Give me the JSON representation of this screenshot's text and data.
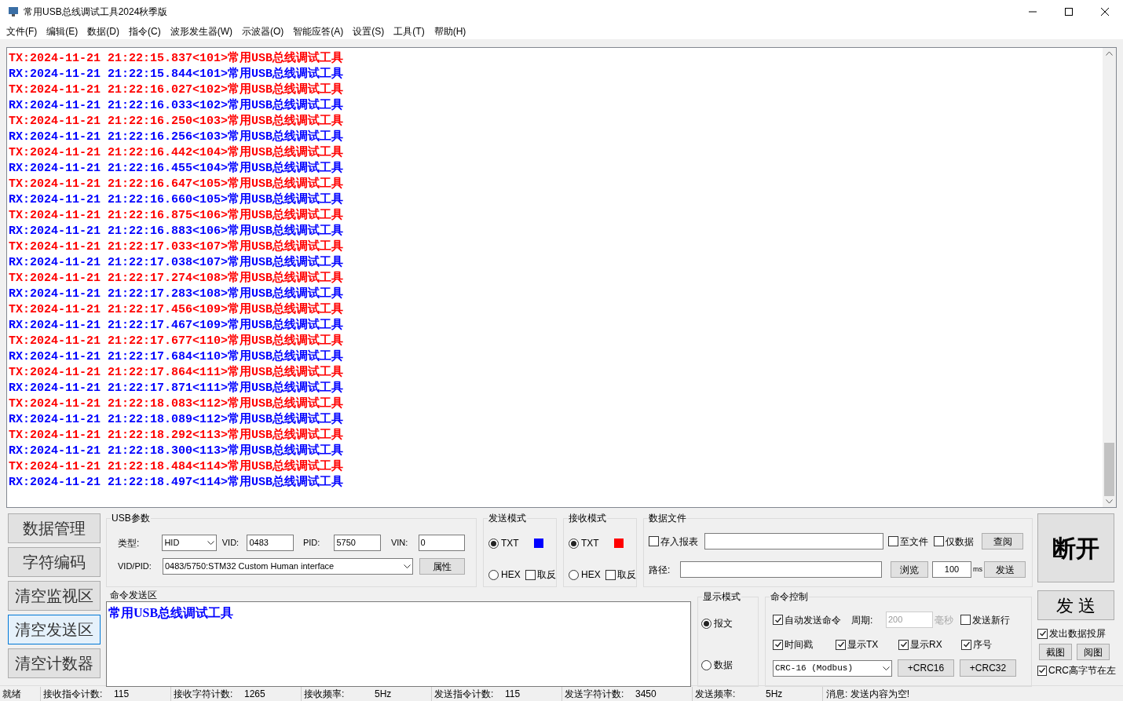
{
  "window": {
    "title": "常用USB总线调试工具2024秋季版"
  },
  "menu": [
    "文件(F)",
    "编辑(E)",
    "数据(D)",
    "指令(C)",
    "波形发生器(W)",
    "示波器(O)",
    "智能应答(A)",
    "设置(S)",
    "工具(T)",
    "帮助(H)"
  ],
  "log": {
    "lines": [
      {
        "kind": "tx",
        "text": "TX:2024-11-21 21:22:15.837<101>常用USB总线调试工具"
      },
      {
        "kind": "rx",
        "text": "RX:2024-11-21 21:22:15.844<101>常用USB总线调试工具"
      },
      {
        "kind": "tx",
        "text": "TX:2024-11-21 21:22:16.027<102>常用USB总线调试工具"
      },
      {
        "kind": "rx",
        "text": "RX:2024-11-21 21:22:16.033<102>常用USB总线调试工具"
      },
      {
        "kind": "tx",
        "text": "TX:2024-11-21 21:22:16.250<103>常用USB总线调试工具"
      },
      {
        "kind": "rx",
        "text": "RX:2024-11-21 21:22:16.256<103>常用USB总线调试工具"
      },
      {
        "kind": "tx",
        "text": "TX:2024-11-21 21:22:16.442<104>常用USB总线调试工具"
      },
      {
        "kind": "rx",
        "text": "RX:2024-11-21 21:22:16.455<104>常用USB总线调试工具"
      },
      {
        "kind": "tx",
        "text": "TX:2024-11-21 21:22:16.647<105>常用USB总线调试工具"
      },
      {
        "kind": "rx",
        "text": "RX:2024-11-21 21:22:16.660<105>常用USB总线调试工具"
      },
      {
        "kind": "tx",
        "text": "TX:2024-11-21 21:22:16.875<106>常用USB总线调试工具"
      },
      {
        "kind": "rx",
        "text": "RX:2024-11-21 21:22:16.883<106>常用USB总线调试工具"
      },
      {
        "kind": "tx",
        "text": "TX:2024-11-21 21:22:17.033<107>常用USB总线调试工具"
      },
      {
        "kind": "rx",
        "text": "RX:2024-11-21 21:22:17.038<107>常用USB总线调试工具"
      },
      {
        "kind": "tx",
        "text": "TX:2024-11-21 21:22:17.274<108>常用USB总线调试工具"
      },
      {
        "kind": "rx",
        "text": "RX:2024-11-21 21:22:17.283<108>常用USB总线调试工具"
      },
      {
        "kind": "tx",
        "text": "TX:2024-11-21 21:22:17.456<109>常用USB总线调试工具"
      },
      {
        "kind": "rx",
        "text": "RX:2024-11-21 21:22:17.467<109>常用USB总线调试工具"
      },
      {
        "kind": "tx",
        "text": "TX:2024-11-21 21:22:17.677<110>常用USB总线调试工具"
      },
      {
        "kind": "rx",
        "text": "RX:2024-11-21 21:22:17.684<110>常用USB总线调试工具"
      },
      {
        "kind": "tx",
        "text": "TX:2024-11-21 21:22:17.864<111>常用USB总线调试工具"
      },
      {
        "kind": "rx",
        "text": "RX:2024-11-21 21:22:17.871<111>常用USB总线调试工具"
      },
      {
        "kind": "tx",
        "text": "TX:2024-11-21 21:22:18.083<112>常用USB总线调试工具"
      },
      {
        "kind": "rx",
        "text": "RX:2024-11-21 21:22:18.089<112>常用USB总线调试工具"
      },
      {
        "kind": "tx",
        "text": "TX:2024-11-21 21:22:18.292<113>常用USB总线调试工具"
      },
      {
        "kind": "rx",
        "text": "RX:2024-11-21 21:22:18.300<113>常用USB总线调试工具"
      },
      {
        "kind": "tx",
        "text": "TX:2024-11-21 21:22:18.484<114>常用USB总线调试工具"
      },
      {
        "kind": "rx",
        "text": "RX:2024-11-21 21:22:18.497<114>常用USB总线调试工具"
      }
    ]
  },
  "side_buttons": [
    {
      "label": "数据管理",
      "selected": false
    },
    {
      "label": "字符编码",
      "selected": false
    },
    {
      "label": "清空监视区",
      "selected": false
    },
    {
      "label": "清空发送区",
      "selected": true
    },
    {
      "label": "清空计数器",
      "selected": false
    }
  ],
  "usb_params": {
    "title": "USB参数",
    "type_label": "类型:",
    "type_value": "HID",
    "vid_label": "VID:",
    "vid": "0483",
    "pid_label": "PID:",
    "pid": "5750",
    "vin_label": "VIN:",
    "vin": "0",
    "vidpid_label": "VID/PID:",
    "vidpid_value": "0483/5750:STM32 Custom Human interface",
    "props_button": "属性"
  },
  "send_mode": {
    "title": "发送模式",
    "options": [
      {
        "label": "TXT",
        "selected": true
      },
      {
        "label": "HEX",
        "selected": false
      }
    ],
    "color": "#0000ff",
    "invert": {
      "label": "取反",
      "checked": false
    }
  },
  "recv_mode": {
    "title": "接收模式",
    "options": [
      {
        "label": "TXT",
        "selected": true
      },
      {
        "label": "HEX",
        "selected": false
      }
    ],
    "color": "#ff0000",
    "invert": {
      "label": "取反",
      "checked": false
    }
  },
  "data_file": {
    "title": "数据文件",
    "save_report": {
      "label": "存入报表",
      "checked": false
    },
    "to_file": {
      "label": "至文件",
      "checked": false
    },
    "data_only": {
      "label": "仅数据",
      "checked": false
    },
    "view_button": "查阅",
    "path_label": "路径:",
    "browse_button": "浏览",
    "interval": "100",
    "unit": "ms",
    "send_button": "发送"
  },
  "disconnect_button": "断开",
  "command_area": {
    "title": "命令发送区",
    "value": "常用USB总线调试工具"
  },
  "display_mode": {
    "title": "显示模式",
    "options": [
      {
        "label": "报文",
        "selected": true
      },
      {
        "label": "数据",
        "selected": false
      }
    ]
  },
  "command_control": {
    "title": "命令控制",
    "auto_send": {
      "label": "自动发送命令",
      "checked": true
    },
    "period_label": "周期:",
    "period": "200",
    "period_disabled": true,
    "period_unit": "毫秒",
    "send_newline": {
      "label": "发送新行",
      "checked": false
    },
    "flags": [
      {
        "label": "时间戳",
        "checked": true
      },
      {
        "label": "显示TX",
        "checked": true
      },
      {
        "label": "显示RX",
        "checked": true
      },
      {
        "label": "序号",
        "checked": true
      }
    ],
    "crc_select": "CRC-16 (Modbus)",
    "crc_buttons": [
      "+CRC16",
      "+CRC32"
    ]
  },
  "send_button": "发 送",
  "projection": {
    "label": "发出数据投屏",
    "checked": true
  },
  "image_buttons": [
    "截图",
    "阅图"
  ],
  "crc_high_left": {
    "label": "CRC高字节在左",
    "checked": true
  },
  "status_bar": {
    "ready": "就绪",
    "counters": [
      {
        "label": "接收指令计数:",
        "value": "115"
      },
      {
        "label": "接收字符计数:",
        "value": "1265"
      },
      {
        "label": "接收频率:",
        "value": "5Hz"
      },
      {
        "label": "发送指令计数:",
        "value": "115"
      },
      {
        "label": "发送字符计数:",
        "value": "3450"
      },
      {
        "label": "发送频率:",
        "value": "5Hz"
      }
    ],
    "message": "消息:  发送内容为空!"
  }
}
